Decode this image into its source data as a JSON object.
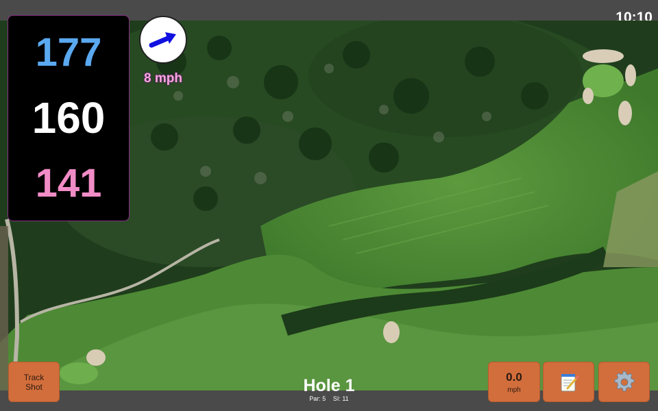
{
  "status": {
    "time": "10:10"
  },
  "distances": {
    "back": "177",
    "middle": "160",
    "front": "141"
  },
  "wind": {
    "speed": "8 mph",
    "icon": "wind-direction-arrow-icon"
  },
  "hole": {
    "title": "Hole 1",
    "par": "Par: 5",
    "si": "SI: 11"
  },
  "buttons": {
    "track_line1": "Track",
    "track_line2": "Shot",
    "speed_value": "0.0",
    "speed_unit": "mph",
    "notes_icon": "notepad-icon",
    "settings_icon": "gear-icon"
  },
  "colors": {
    "back_distance": "#5aa8f0",
    "middle_distance": "#ffffff",
    "front_distance": "#f28cc6",
    "button": "#d26e3c",
    "wind_arrow": "#1010e0"
  }
}
